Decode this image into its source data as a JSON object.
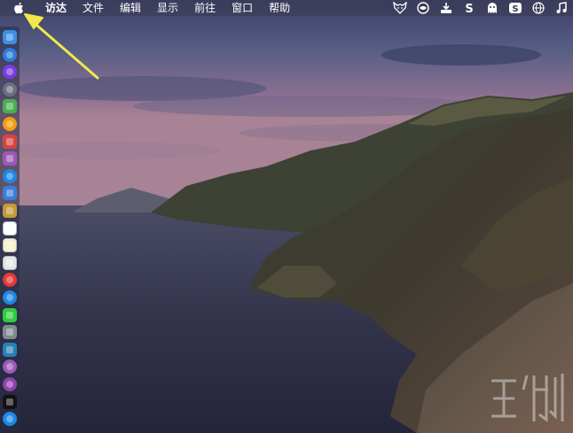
{
  "menubar": {
    "items": [
      {
        "label": "访达",
        "bold": true
      },
      {
        "label": "文件"
      },
      {
        "label": "编辑"
      },
      {
        "label": "显示"
      },
      {
        "label": "前往"
      },
      {
        "label": "窗口"
      },
      {
        "label": "帮助"
      }
    ],
    "apple_icon": "apple-logo-icon",
    "status_icons": [
      "fox-icon",
      "vpn-shield-icon",
      "download-icon",
      "s-app-icon",
      "ghost-icon",
      "s-box-icon",
      "globe-icon",
      "music-note-icon"
    ]
  },
  "dock": {
    "items": [
      {
        "name": "finder-icon",
        "color": "#3d8fe0"
      },
      {
        "name": "safari-icon",
        "color": "#2f7bd8"
      },
      {
        "name": "siri-icon",
        "color": "#7d3be0"
      },
      {
        "name": "launchpad-icon",
        "color": "#6b6f80"
      },
      {
        "name": "android-icon",
        "color": "#4caf50"
      },
      {
        "name": "photos-icon",
        "color": "#f39c12"
      },
      {
        "name": "app-red-icon",
        "color": "#d64541"
      },
      {
        "name": "disk-icon",
        "color": "#9b59b6"
      },
      {
        "name": "appstore-icon",
        "color": "#1e88e5"
      },
      {
        "name": "preview-icon",
        "color": "#3b7dd8"
      },
      {
        "name": "notes-brown-icon",
        "color": "#c49a3a"
      },
      {
        "name": "calendar-icon",
        "color": "#ffffff"
      },
      {
        "name": "notes-icon",
        "color": "#f5f0d0"
      },
      {
        "name": "photos-alt-icon",
        "color": "#e6e6e6"
      },
      {
        "name": "chrome-icon",
        "color": "#e53935"
      },
      {
        "name": "qq-icon",
        "color": "#1e88e5"
      },
      {
        "name": "wechat-icon",
        "color": "#2ecc40"
      },
      {
        "name": "system-preferences-icon",
        "color": "#7f8c8d"
      },
      {
        "name": "keynote-icon",
        "color": "#2980b9"
      },
      {
        "name": "itunes-icon",
        "color": "#9b59b6"
      },
      {
        "name": "podcasts-icon",
        "color": "#8e44ad"
      },
      {
        "name": "apple-tv-icon",
        "color": "#111111"
      },
      {
        "name": "appstore-bottom-icon",
        "color": "#1e88e5"
      }
    ]
  },
  "annotation": {
    "arrow_color": "#f1e84a"
  }
}
